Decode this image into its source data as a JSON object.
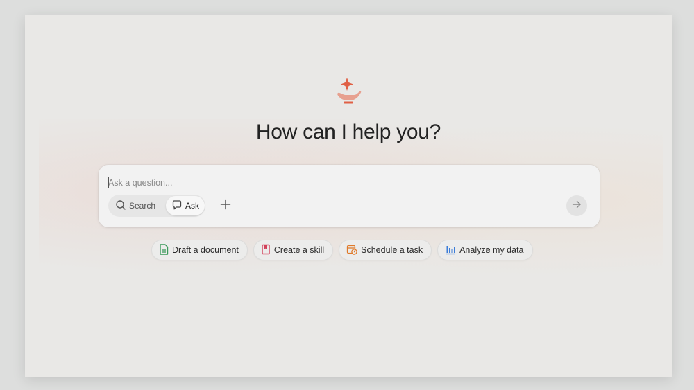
{
  "heading": "How can I help you?",
  "composer": {
    "placeholder": "Ask a question...",
    "modes": [
      {
        "label": "Search",
        "icon": "search-icon",
        "selected": false
      },
      {
        "label": "Ask",
        "icon": "chat-bubble-icon",
        "selected": true
      }
    ],
    "add_icon": "plus-icon",
    "send_icon": "arrow-right-icon"
  },
  "suggestions": [
    {
      "label": "Draft a document",
      "icon": "document-icon",
      "color": "#3a9a5a"
    },
    {
      "label": "Create a skill",
      "icon": "bookmark-icon",
      "color": "#d2405a"
    },
    {
      "label": "Schedule a task",
      "icon": "calendar-clock-icon",
      "color": "#e07a2a"
    },
    {
      "label": "Analyze my data",
      "icon": "bar-chart-icon",
      "color": "#3b7dd8"
    }
  ],
  "colors": {
    "brand": "#e06045",
    "background": "#e9e8e6",
    "composer": "#f2f2f2"
  }
}
